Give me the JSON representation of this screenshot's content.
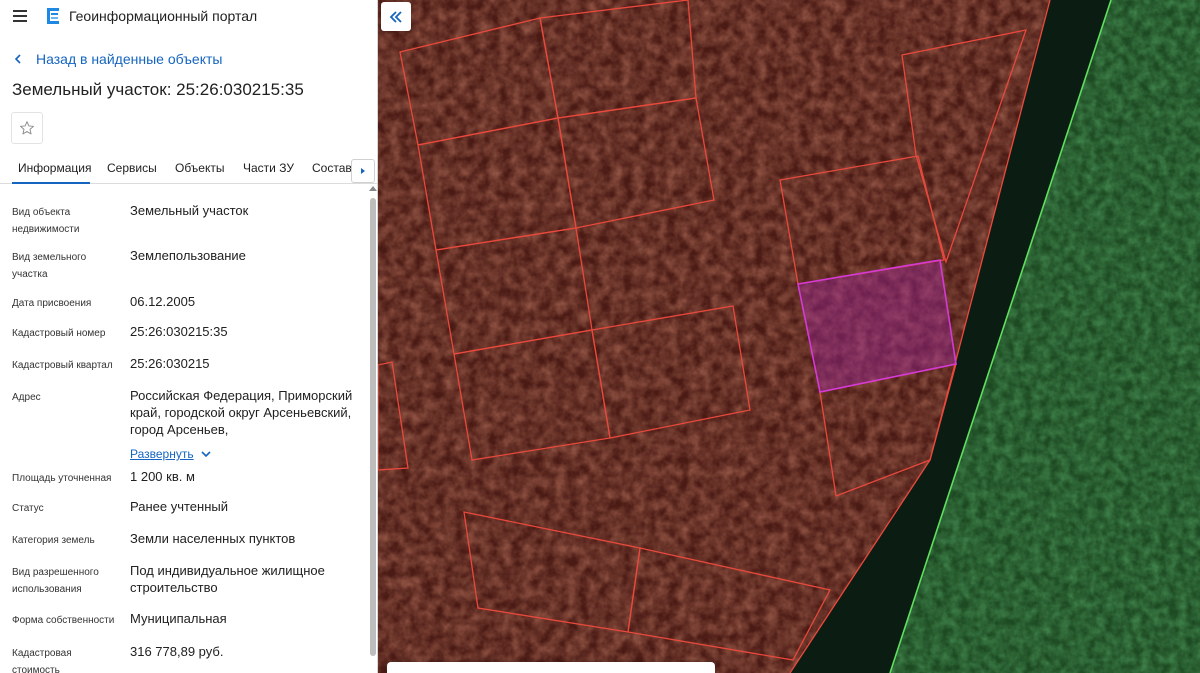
{
  "header": {
    "app_title": "Геоинформационный портал",
    "menu_icon": "menu-icon",
    "logo_icon": "portal-logo-icon"
  },
  "nav": {
    "back_label": "Назад в найденные объекты"
  },
  "object": {
    "title": "Земельный участок: 25:26:030215:35"
  },
  "tabs": [
    {
      "label": "Информация",
      "active": true
    },
    {
      "label": "Сервисы",
      "active": false
    },
    {
      "label": "Объекты",
      "active": false
    },
    {
      "label": "Части ЗУ",
      "active": false
    },
    {
      "label": "Состав",
      "active": false
    }
  ],
  "info": {
    "rows": [
      {
        "label": "Вид объекта недвижимости",
        "value": "Земельный участок"
      },
      {
        "label": "Вид земельного участка",
        "value": "Землепользование"
      },
      {
        "label": "Дата присвоения",
        "value": "06.12.2005"
      },
      {
        "label": "Кадастровый номер",
        "value": "25:26:030215:35"
      },
      {
        "label": "Кадастровый квартал",
        "value": "25:26:030215"
      },
      {
        "label": "Адрес",
        "value": "Российская Федерация, Приморский край, городской округ Арсеньевский, город Арсеньев,",
        "expand_label": "Развернуть"
      },
      {
        "label": "Площадь уточненная",
        "value": "1 200 кв. м"
      },
      {
        "label": "Статус",
        "value": "Ранее учтенный"
      },
      {
        "label": "Категория земель",
        "value": "Земли населенных пунктов"
      },
      {
        "label": "Вид разрешенного использования",
        "value": "Под индивидуальное жилищное строительство"
      },
      {
        "label": "Форма собственности",
        "value": "Муниципальная"
      },
      {
        "label": "Кадастровая стоимость",
        "value": "316 778,89 руб."
      }
    ]
  },
  "map": {
    "parcel_stroke": "#e8493c",
    "selected_stroke": "#d63ad6",
    "boundary_stroke": "#5fe05f"
  },
  "colors": {
    "accent": "#1565c0"
  }
}
